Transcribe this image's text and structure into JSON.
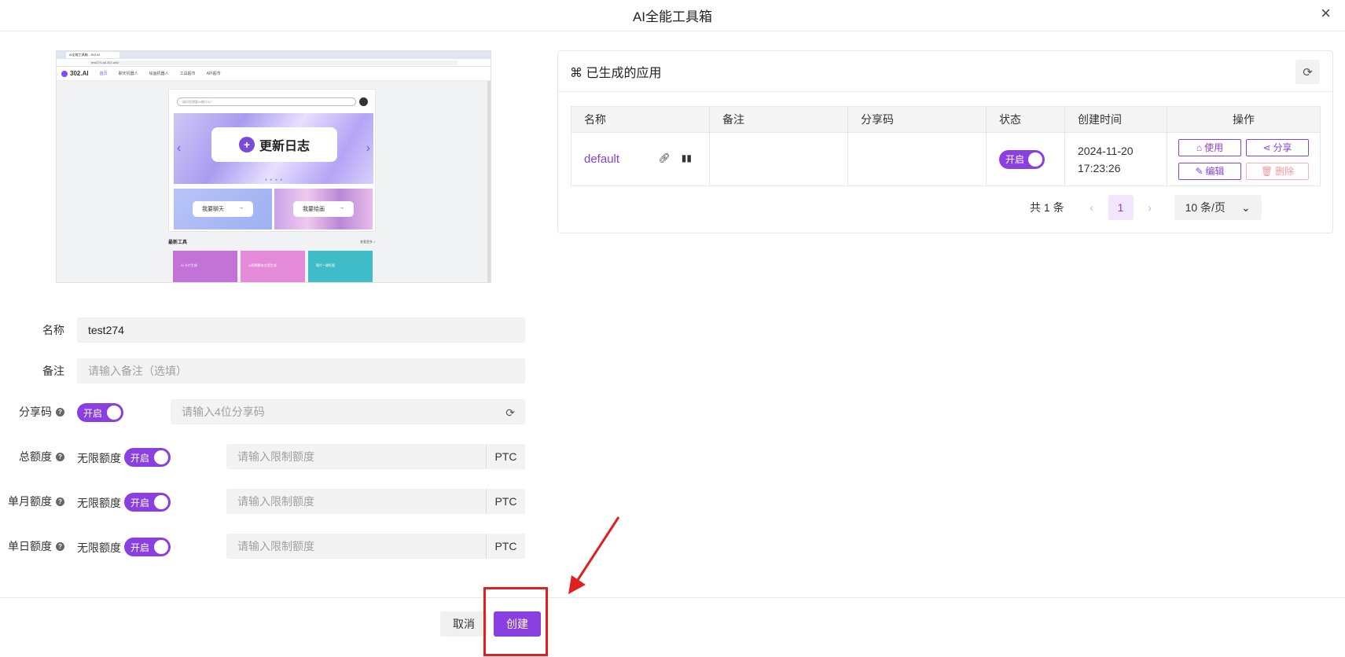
{
  "modal": {
    "title": "AI全能工具箱",
    "close": "×"
  },
  "preview": {
    "tab_title": "AI全能工具箱 - 302.AI",
    "url": "test274-a8.302.ai/#/",
    "logo": "302.AI",
    "nav": [
      "首页",
      "聊天机器人",
      "绘画机器人",
      "工具超市",
      "API超市"
    ],
    "search_placeholder": "请问您想要AI做什么？",
    "banner_text": "更新日志",
    "dots": "● ● ● ●",
    "chat_label": "我要聊天",
    "draw_label": "我要绘画",
    "arrow": "→",
    "tools_title": "最新工具",
    "more": "查看更多 >",
    "tools": [
      "AI 卡片生成",
      "AI视频脚本文案生成",
      "图片一键抠图"
    ]
  },
  "form": {
    "name_label": "名称",
    "name_value": "test274",
    "remark_label": "备注",
    "remark_placeholder": "请输入备注（选填）",
    "share_label": "分享码",
    "share_toggle": "开启",
    "share_placeholder": "请输入4位分享码",
    "total_label": "总额度",
    "monthly_label": "单月额度",
    "daily_label": "单日额度",
    "no_limit": "无限额度",
    "toggle_on": "开启",
    "limit_placeholder": "请输入限制额度",
    "unit": "PTC",
    "help": "?"
  },
  "footer": {
    "cancel": "取消",
    "create": "创建"
  },
  "apps_panel": {
    "title": "⌘ 已生成的应用",
    "columns": [
      "名称",
      "备注",
      "分享码",
      "状态",
      "创建时间",
      "操作"
    ],
    "rows": [
      {
        "name": "default",
        "remark": "",
        "share_code": "",
        "status": "开启",
        "created_date": "2024-11-20",
        "created_time": "17:23:26",
        "ops": {
          "use": "使用",
          "share": "分享",
          "edit": "编辑",
          "delete": "删除"
        }
      }
    ],
    "pagination": {
      "total": "共 1 条",
      "current": "1",
      "page_size": "10 条/页"
    }
  },
  "colors": {
    "accent": "#8a3fe0",
    "annotation": "#e02020"
  }
}
